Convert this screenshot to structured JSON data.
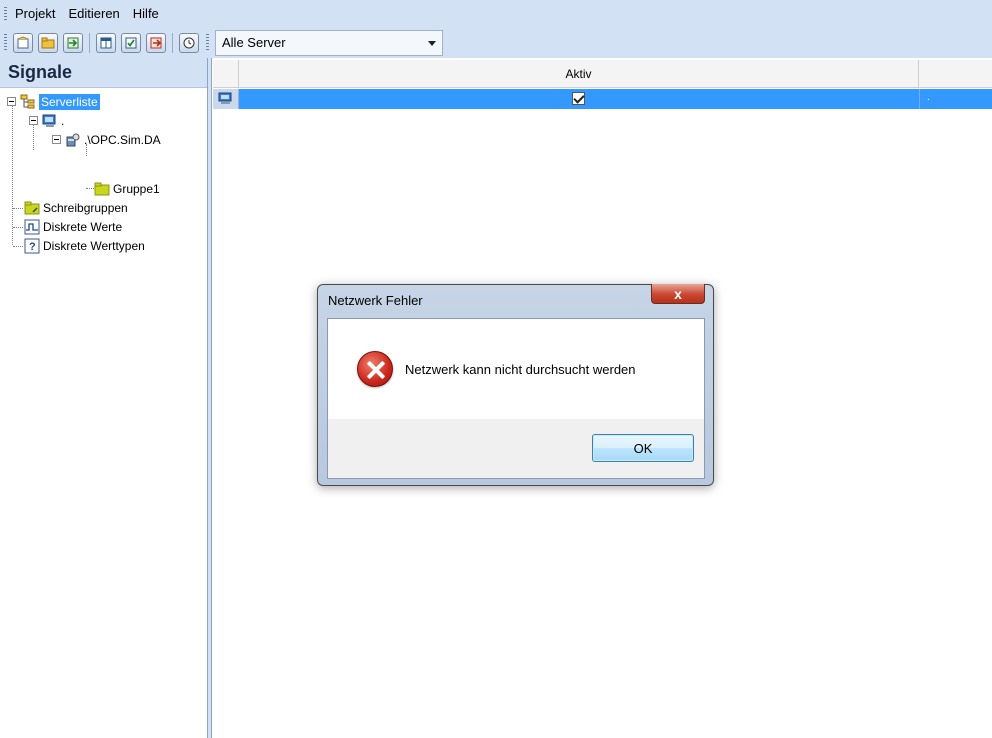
{
  "menu": {
    "items": [
      "Projekt",
      "Editieren",
      "Hilfe"
    ]
  },
  "toolbar": {
    "buttons": [
      "new-project-icon",
      "open-folder-icon",
      "import-icon",
      "window-icon",
      "check-icon",
      "export-icon",
      "clock-icon"
    ],
    "server_filter": "Alle Server"
  },
  "left_panel": {
    "title": "Signale",
    "tree": {
      "serverliste": "Serverliste",
      "computer_node": ".",
      "opc_server": ".\\OPC.Sim.DA",
      "group": "Gruppe1",
      "schreibgruppen": "Schreibgruppen",
      "diskrete_werte": "Diskrete Werte",
      "diskrete_werttypen": "Diskrete Werttypen"
    }
  },
  "grid": {
    "columns": [
      "Aktiv"
    ],
    "rows": [
      {
        "aktiv": true,
        "extra": "."
      }
    ]
  },
  "dialog": {
    "title": "Netzwerk Fehler",
    "close_label": "x",
    "message": "Netzwerk kann nicht durchsucht werden",
    "ok_label": "OK"
  },
  "colors": {
    "selection": "#3399ff",
    "chrome": "#d3e1f5",
    "error": "#c9271b"
  }
}
